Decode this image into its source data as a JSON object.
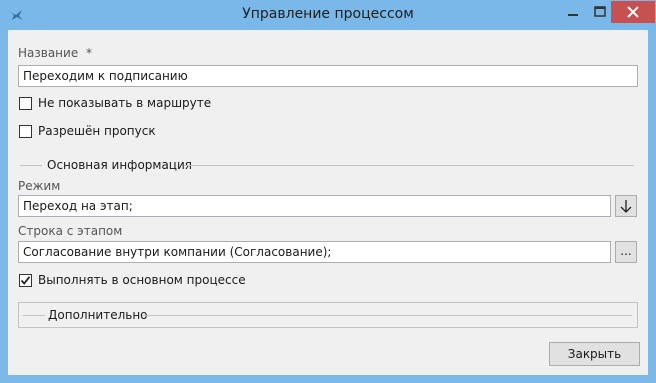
{
  "window": {
    "title": "Управление процессом",
    "titlebar_color": "#79b8e8",
    "close_color": "#c75050"
  },
  "form": {
    "name_label": "Название",
    "required_mark": "*",
    "name_value": "Переходим к подписанию",
    "hide_in_route_label": "Не показывать в маршруте",
    "hide_in_route_checked": false,
    "skip_allowed_label": "Разрешён пропуск",
    "skip_allowed_checked": false,
    "main_info_section": "Основная информация",
    "mode_label": "Режим",
    "mode_value": "Переход на этап;",
    "mode_button_icon": "arrow-down-icon",
    "stage_row_label": "Строка с этапом",
    "stage_row_value": "Согласование внутри компании (Согласование);",
    "stage_row_button": "...",
    "run_in_main_label": "Выполнять в основном процессе",
    "run_in_main_checked": true,
    "additional_section": "Дополнительно"
  },
  "footer": {
    "close_label": "Закрыть"
  }
}
